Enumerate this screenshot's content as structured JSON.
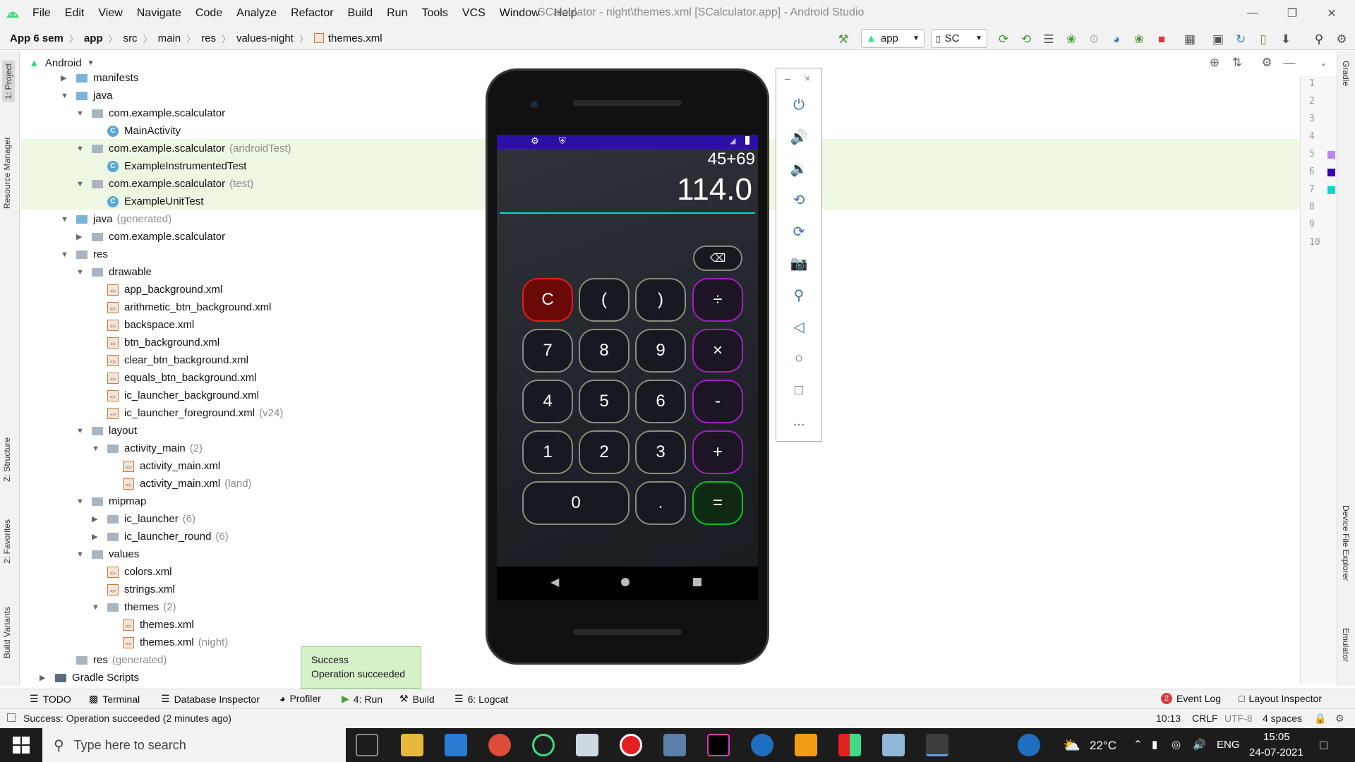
{
  "menubar": {
    "items": [
      "File",
      "Edit",
      "View",
      "Navigate",
      "Code",
      "Analyze",
      "Refactor",
      "Build",
      "Run",
      "Tools",
      "VCS",
      "Window",
      "Help"
    ],
    "window_title": "SCalculator - night\\themes.xml [SCalculator.app] - Android Studio"
  },
  "navbar": {
    "breadcrumbs": [
      "App 6 sem",
      "app",
      "src",
      "main",
      "res",
      "values-night",
      "themes.xml"
    ],
    "run_config": "app",
    "device": "SC"
  },
  "left_strip": {
    "project": "1: Project",
    "resource_manager": "Resource Manager",
    "structure": "Z: Structure",
    "favorites": "2: Favorites",
    "build_variants": "Build Variants"
  },
  "right_strip": {
    "gradle": "Gradle",
    "device_file_explorer": "Device File Explorer",
    "emulator": "Emulator"
  },
  "project_panel": {
    "view": "Android",
    "tree": [
      {
        "label": "manifests",
        "depth": 1,
        "icon": "folder-blue",
        "arrow": "right"
      },
      {
        "label": "java",
        "depth": 1,
        "icon": "folder-blue",
        "arrow": "down"
      },
      {
        "label": "com.example.scalculator",
        "depth": 2,
        "icon": "package",
        "arrow": "down"
      },
      {
        "label": "MainActivity",
        "depth": 3,
        "icon": "class"
      },
      {
        "label": "com.example.scalculator",
        "suffix": "(androidTest)",
        "depth": 2,
        "icon": "package",
        "arrow": "down",
        "hl": true
      },
      {
        "label": "ExampleInstrumentedTest",
        "depth": 3,
        "icon": "class",
        "hl": true
      },
      {
        "label": "com.example.scalculator",
        "suffix": "(test)",
        "depth": 2,
        "icon": "package",
        "arrow": "down",
        "hl": true
      },
      {
        "label": "ExampleUnitTest",
        "depth": 3,
        "icon": "class",
        "hl": true
      },
      {
        "label": "java",
        "suffix": "(generated)",
        "depth": 1,
        "icon": "folder-blue",
        "arrow": "down"
      },
      {
        "label": "com.example.scalculator",
        "depth": 2,
        "icon": "package",
        "arrow": "right"
      },
      {
        "label": "res",
        "depth": 1,
        "icon": "folder",
        "arrow": "down"
      },
      {
        "label": "drawable",
        "depth": 2,
        "icon": "folder",
        "arrow": "down"
      },
      {
        "label": "app_background.xml",
        "depth": 3,
        "icon": "xml"
      },
      {
        "label": "arithmetic_btn_background.xml",
        "depth": 3,
        "icon": "xml"
      },
      {
        "label": "backspace.xml",
        "depth": 3,
        "icon": "xml"
      },
      {
        "label": "btn_background.xml",
        "depth": 3,
        "icon": "xml"
      },
      {
        "label": "clear_btn_background.xml",
        "depth": 3,
        "icon": "xml"
      },
      {
        "label": "equals_btn_background.xml",
        "depth": 3,
        "icon": "xml"
      },
      {
        "label": "ic_launcher_background.xml",
        "depth": 3,
        "icon": "xml"
      },
      {
        "label": "ic_launcher_foreground.xml",
        "suffix": "(v24)",
        "depth": 3,
        "icon": "xml"
      },
      {
        "label": "layout",
        "depth": 2,
        "icon": "folder",
        "arrow": "down"
      },
      {
        "label": "activity_main",
        "suffix": "(2)",
        "depth": 3,
        "icon": "folder",
        "arrow": "down"
      },
      {
        "label": "activity_main.xml",
        "depth": 4,
        "icon": "xml"
      },
      {
        "label": "activity_main.xml",
        "suffix": "(land)",
        "depth": 4,
        "icon": "xml"
      },
      {
        "label": "mipmap",
        "depth": 2,
        "icon": "folder",
        "arrow": "down"
      },
      {
        "label": "ic_launcher",
        "suffix": "(6)",
        "depth": 3,
        "icon": "folder",
        "arrow": "right"
      },
      {
        "label": "ic_launcher_round",
        "suffix": "(6)",
        "depth": 3,
        "icon": "folder",
        "arrow": "right"
      },
      {
        "label": "values",
        "depth": 2,
        "icon": "folder",
        "arrow": "down"
      },
      {
        "label": "colors.xml",
        "depth": 3,
        "icon": "xml"
      },
      {
        "label": "strings.xml",
        "depth": 3,
        "icon": "xml"
      },
      {
        "label": "themes",
        "suffix": "(2)",
        "depth": 3,
        "icon": "folder",
        "arrow": "down"
      },
      {
        "label": "themes.xml",
        "depth": 4,
        "icon": "xml"
      },
      {
        "label": "themes.xml",
        "suffix": "(night)",
        "depth": 4,
        "icon": "xml"
      },
      {
        "label": "res",
        "suffix": "(generated)",
        "depth": 1,
        "icon": "folder"
      },
      {
        "label": "Gradle Scripts",
        "depth": 0,
        "icon": "gradle",
        "arrow": "right"
      }
    ]
  },
  "editor": {
    "line_numbers": [
      "1",
      "2",
      "3",
      "4",
      "5",
      "6",
      "7",
      "8",
      "9",
      "10"
    ],
    "color_swatches": [
      {
        "line": "5",
        "color": "#bb86fc"
      },
      {
        "line": "6",
        "color": "#3700b3"
      },
      {
        "line": "7",
        "color": "#03dac5"
      }
    ]
  },
  "emulator": {
    "expression": "45+69",
    "result": "114.0",
    "buttons": [
      [
        "C",
        "(",
        ")",
        "÷"
      ],
      [
        "7",
        "8",
        "9",
        "×"
      ],
      [
        "4",
        "5",
        "6",
        "-"
      ],
      [
        "1",
        "2",
        "3",
        "+"
      ],
      [
        "0",
        ".",
        "="
      ]
    ],
    "sidebar_min": "–",
    "sidebar_close": "×",
    "sidebar_more": "..."
  },
  "toast": {
    "title": "Success",
    "message": "Operation succeeded"
  },
  "bottom_tools": {
    "todo": "TODO",
    "terminal": "Terminal",
    "db": "Database Inspector",
    "profiler": "Profiler",
    "run": "4: Run",
    "build": "Build",
    "logcat": "6: Logcat",
    "event_log": "Event Log",
    "event_count": "2",
    "layout_inspector": "Layout Inspector"
  },
  "status": {
    "message": "Success: Operation succeeded (2 minutes ago)",
    "position": "10:13",
    "line_sep": "CRLF",
    "encoding": "UTF-8",
    "indent": "4 spaces"
  },
  "taskbar": {
    "search_placeholder": "Type here to search",
    "temperature": "22°C",
    "lang": "ENG",
    "time": "15:05",
    "date": "24-07-2021"
  },
  "colors": {
    "status_bar": "#2d0fa8",
    "accent": "#03dac5",
    "op_border": "#a020c0",
    "clear_border": "#e31f1f",
    "equals_border": "#10c020",
    "highlight": "#edf7e3"
  }
}
